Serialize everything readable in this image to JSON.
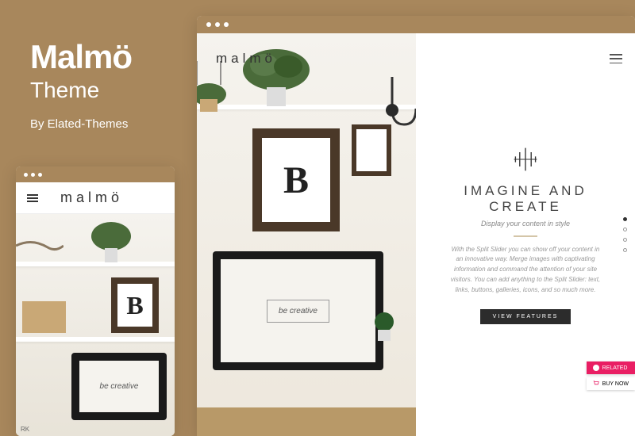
{
  "title": {
    "main": "Malmö",
    "sub": "Theme",
    "by": "By Elated-Themes"
  },
  "logo_text": "malmö",
  "split": {
    "heading": "IMAGINE AND CREATE",
    "subheading": "Display your content in style",
    "body": "With the Split Slider you can show off your content in an innovative way. Merge images with captivating information and command the attention of your site visitors. You can add anything to the Split Slider: text, links, buttons, galleries, icons, and so much more.",
    "cta": "VIEW FEATURES"
  },
  "scene": {
    "frame_letter": "B",
    "monitor_text": "be creative"
  },
  "badges": {
    "related": "RELATED",
    "buynow": "BUY NOW"
  },
  "mobile_footer": "RK"
}
